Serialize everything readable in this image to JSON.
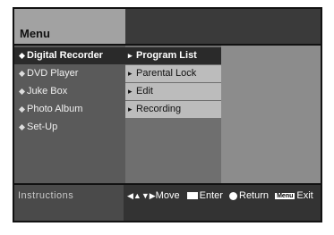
{
  "header": {
    "title": "Menu"
  },
  "main_menu": {
    "items": [
      {
        "label": "Digital Recorder",
        "selected": true
      },
      {
        "label": "DVD Player",
        "selected": false
      },
      {
        "label": "Juke Box",
        "selected": false
      },
      {
        "label": "Photo Album",
        "selected": false
      },
      {
        "label": "Set-Up",
        "selected": false
      }
    ]
  },
  "sub_menu": {
    "items": [
      {
        "label": "Program List",
        "selected": true
      },
      {
        "label": "Parental Lock",
        "selected": false
      },
      {
        "label": "Edit",
        "selected": false
      },
      {
        "label": "Recording",
        "selected": false
      }
    ]
  },
  "footer": {
    "instructions_label": "Instructions",
    "move_label": "Move",
    "enter_label": "Enter",
    "return_label": "Return",
    "menu_key_label": "Menu",
    "exit_label": "Exit"
  }
}
